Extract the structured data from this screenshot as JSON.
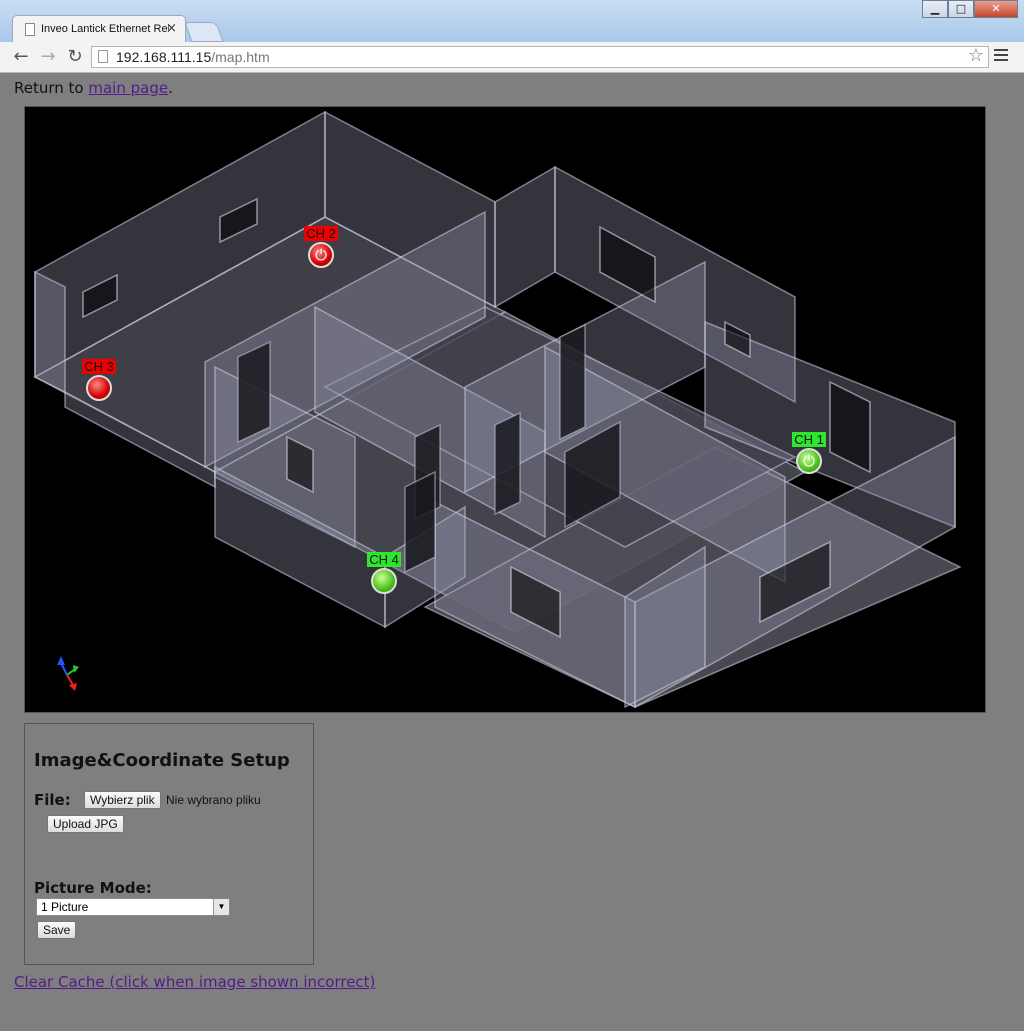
{
  "browser": {
    "tab_title": "Inveo Lantick Ethernet Rel",
    "tab_close": "×",
    "url_host": "192.168.111.15",
    "url_path": "/map.htm",
    "back_icon": "←",
    "forward_icon": "→",
    "reload_icon": "↻",
    "star_icon": "☆",
    "minimize": "▁",
    "maximize": "□",
    "close": "✕"
  },
  "page": {
    "return_prefix": "Return to ",
    "return_link": "main page",
    "return_suffix": ".",
    "clear_cache": "Clear Cache (click when image shown incorrect)"
  },
  "map": {
    "channels": [
      {
        "label": "CH 2",
        "state": "off",
        "icon": "power-icon",
        "glyph": "⏻"
      },
      {
        "label": "CH 3",
        "state": "off",
        "icon": "indicator-icon",
        "glyph": ""
      },
      {
        "label": "CH 1",
        "state": "on",
        "icon": "power-icon",
        "glyph": "⏻"
      },
      {
        "label": "CH 4",
        "state": "on",
        "icon": "indicator-icon",
        "glyph": ""
      }
    ],
    "colors": {
      "on": "#2ee62e",
      "off": "#e00000"
    }
  },
  "setup": {
    "title": "Image&Coordinate Setup",
    "file_label": "File:",
    "choose_button": "Wybierz plik",
    "no_file": "Nie wybrano pliku",
    "upload_button": "Upload JPG",
    "mode_label": "Picture Mode:",
    "mode_value": "1 Picture",
    "save_button": "Save"
  }
}
